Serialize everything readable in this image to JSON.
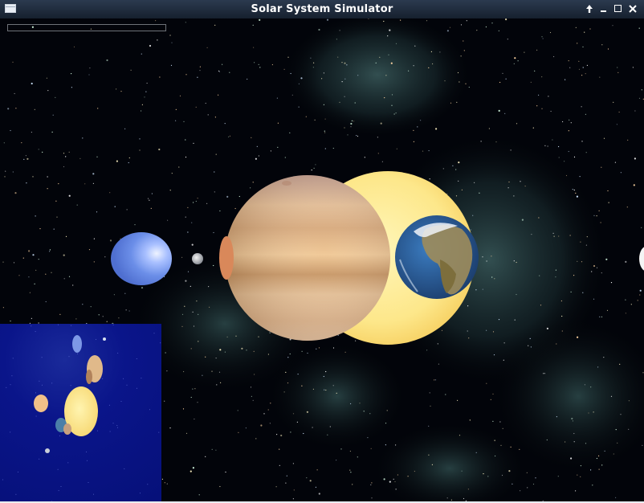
{
  "window": {
    "title": "Solar System Simulator",
    "controls": [
      "menu-icon",
      "arrow-up-icon",
      "minimize-icon",
      "maximize-icon",
      "close-icon"
    ]
  },
  "scene": {
    "background": "starfield with green-teal nebula",
    "bodies": [
      "Neptune",
      "Moon",
      "Jupiter",
      "Sun",
      "Earth"
    ],
    "progress": 0
  },
  "minimap": {
    "background_color": "#07117d"
  },
  "colors": {
    "titlebar": "#1f2b3b",
    "sun": "#fde78a",
    "jupiter": "#e3b887",
    "earth_ocean": "#2a5f9a",
    "neptune": "#6b8ee8",
    "minimap": "#07117d"
  }
}
